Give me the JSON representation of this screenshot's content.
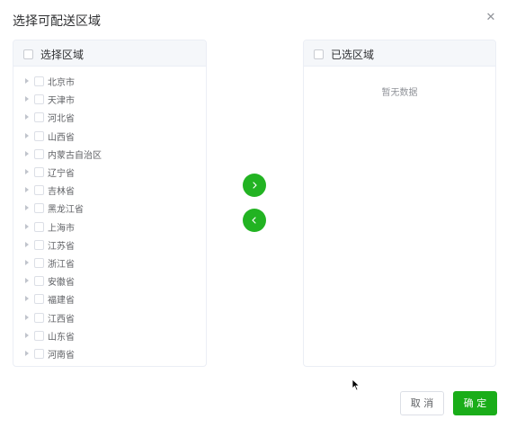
{
  "dialog": {
    "title": "选择可配送区域",
    "close_icon": "close-icon"
  },
  "left_panel": {
    "header_label": "选择区域",
    "items": [
      {
        "label": "北京市"
      },
      {
        "label": "天津市"
      },
      {
        "label": "河北省"
      },
      {
        "label": "山西省"
      },
      {
        "label": "内蒙古自治区"
      },
      {
        "label": "辽宁省"
      },
      {
        "label": "吉林省"
      },
      {
        "label": "黑龙江省"
      },
      {
        "label": "上海市"
      },
      {
        "label": "江苏省"
      },
      {
        "label": "浙江省"
      },
      {
        "label": "安徽省"
      },
      {
        "label": "福建省"
      },
      {
        "label": "江西省"
      },
      {
        "label": "山东省"
      },
      {
        "label": "河南省"
      }
    ]
  },
  "right_panel": {
    "header_label": "已选区域",
    "empty_text": "暂无数据"
  },
  "transfer": {
    "to_right_icon": "chevron-right-icon",
    "to_left_icon": "chevron-left-icon",
    "color": "#22b322"
  },
  "footer": {
    "cancel_label": "取 消",
    "confirm_label": "确 定",
    "confirm_color": "#1aad19"
  }
}
